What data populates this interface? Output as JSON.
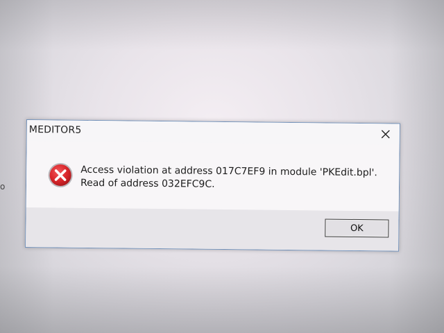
{
  "dialog": {
    "title": "MEDITOR5",
    "close_icon": "close-icon",
    "icon": "error-icon",
    "message": "Access violation at address 017C7EF9 in module 'PKEdit.bpl'. Read of address 032EFC9C.",
    "ok_label": "OK"
  },
  "background": {
    "edge_fragment": "o"
  },
  "colors": {
    "error_red": "#d9262b",
    "border_blue": "#6f8fb8"
  }
}
